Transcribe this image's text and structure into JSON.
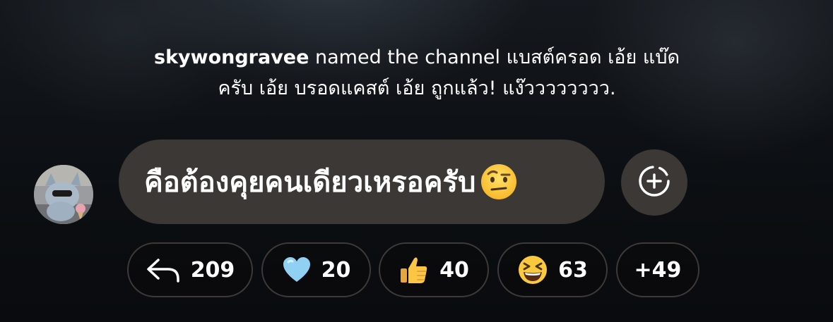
{
  "system_message": {
    "username": "skywongravee",
    "line1_rest": " named the channel แบสต์ครอด เอ้ย แบ๊ด",
    "line2": "ครับ เอ้ย บรอดแคสต์ เอ้ย ถูกแล้ว! แง๊วววววววว."
  },
  "message": {
    "text": "คือต้องคุยคนเดียวเหรอครับ",
    "emoji_icon": "face-with-raised-eyebrow-icon"
  },
  "actions": {
    "add_reaction_icon": "add-reaction-icon"
  },
  "reactions": [
    {
      "icon": "reply-arrow-icon",
      "count": "209"
    },
    {
      "icon": "light-blue-heart-icon",
      "count": "20"
    },
    {
      "icon": "thumbs-up-icon",
      "count": "40"
    },
    {
      "icon": "grinning-squinting-face-icon",
      "count": "63"
    },
    {
      "icon": "more-reactions",
      "count": "+49"
    }
  ],
  "colors": {
    "bubble": "#3b3835",
    "pill_border": "#3d3a37",
    "text": "#ffffff",
    "background": "#0d1014"
  }
}
